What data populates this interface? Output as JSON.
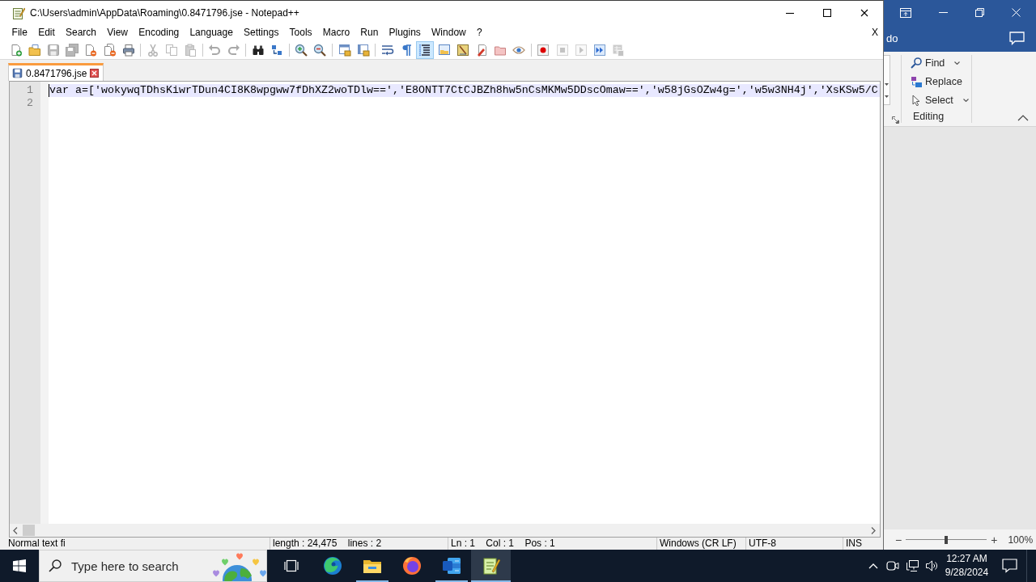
{
  "editor_window": {
    "title": "C:\\Users\\admin\\AppData\\Roaming\\0.8471796.jse - Notepad++",
    "menu": [
      "File",
      "Edit",
      "Search",
      "View",
      "Encoding",
      "Language",
      "Settings",
      "Tools",
      "Macro",
      "Run",
      "Plugins",
      "Window",
      "?"
    ],
    "close_document": "X",
    "toolbar": [
      [
        {
          "kind": "new",
          "disabled": false,
          "pressed": false
        },
        {
          "kind": "open",
          "disabled": false,
          "pressed": false
        },
        {
          "kind": "save",
          "disabled": true,
          "pressed": false
        },
        {
          "kind": "saveall",
          "disabled": true,
          "pressed": false
        },
        {
          "kind": "close",
          "disabled": false,
          "pressed": false
        },
        {
          "kind": "closeall",
          "disabled": false,
          "pressed": false
        },
        {
          "kind": "print",
          "disabled": false,
          "pressed": false
        }
      ],
      [
        {
          "kind": "cut",
          "disabled": true,
          "pressed": false
        },
        {
          "kind": "copy",
          "disabled": true,
          "pressed": false
        },
        {
          "kind": "paste",
          "disabled": true,
          "pressed": false
        }
      ],
      [
        {
          "kind": "undo",
          "disabled": true,
          "pressed": false
        },
        {
          "kind": "redo",
          "disabled": true,
          "pressed": false
        }
      ],
      [
        {
          "kind": "find",
          "disabled": false,
          "pressed": false
        },
        {
          "kind": "replace",
          "disabled": false,
          "pressed": false
        }
      ],
      [
        {
          "kind": "zoomin",
          "disabled": false,
          "pressed": false
        },
        {
          "kind": "zoomout",
          "disabled": false,
          "pressed": false
        }
      ],
      [
        {
          "kind": "syncv",
          "disabled": false,
          "pressed": false
        },
        {
          "kind": "synch",
          "disabled": false,
          "pressed": false
        }
      ],
      [
        {
          "kind": "wrap",
          "disabled": false,
          "pressed": false
        },
        {
          "kind": "allchars",
          "disabled": false,
          "pressed": false
        },
        {
          "kind": "indent",
          "disabled": false,
          "pressed": true
        },
        {
          "kind": "udl",
          "disabled": false,
          "pressed": false
        },
        {
          "kind": "docmap",
          "disabled": false,
          "pressed": false
        },
        {
          "kind": "funclist",
          "disabled": false,
          "pressed": false
        },
        {
          "kind": "folder",
          "disabled": false,
          "pressed": false
        },
        {
          "kind": "monitor",
          "disabled": false,
          "pressed": false
        }
      ],
      [
        {
          "kind": "record",
          "disabled": false,
          "pressed": false
        },
        {
          "kind": "stop",
          "disabled": true,
          "pressed": false
        },
        {
          "kind": "play",
          "disabled": true,
          "pressed": false
        },
        {
          "kind": "playmulti",
          "disabled": false,
          "pressed": false
        },
        {
          "kind": "savemacro",
          "disabled": true,
          "pressed": false
        }
      ]
    ],
    "tabs": [
      {
        "label": "0.8471796.jse",
        "selected": true
      }
    ],
    "lines": [
      {
        "number": "1",
        "text": "var a=['wokywqTDhsKiwrTDun4CI8K8wpgww7fDhXZ2woTDlw==','E8ONTT7CtCJBZh8hw5nCsMKMw5DDscOmaw==','w58jGsOZw4g=','w5w3NH4j','XsKSw5/C",
        "current": true
      },
      {
        "number": "2",
        "current": false
      }
    ],
    "status_bar": [
      "Normal text fi",
      "length : 24,475    lines : 2",
      "Ln : 1    Col : 1    Pos : 1",
      "Windows (CR LF)",
      "UTF-8",
      "INS"
    ]
  },
  "word_window": {
    "tell_me": "do",
    "editing": [
      {
        "label": "Find",
        "kind": "find",
        "dropdown": true
      },
      {
        "label": "Replace",
        "kind": "replace",
        "dropdown": false
      },
      {
        "label": "Select",
        "kind": "select",
        "dropdown": true
      }
    ],
    "group_label": "Editing",
    "zoom": {
      "minus": "−",
      "plus": "+",
      "level": 0.5,
      "reading": "100%"
    }
  },
  "taskbar": {
    "search": {
      "placeholder": "Type here to search"
    },
    "apps": [
      {
        "kind": "edge",
        "running": false,
        "selected": false
      },
      {
        "kind": "explorer",
        "running": true,
        "selected": false
      },
      {
        "kind": "firefox",
        "running": false,
        "selected": false
      },
      {
        "kind": "word",
        "running": true,
        "selected": false
      },
      {
        "kind": "notepad",
        "running": true,
        "selected": true
      }
    ],
    "clock": {
      "time": "12:27 AM",
      "date": "9/28/2024"
    }
  }
}
